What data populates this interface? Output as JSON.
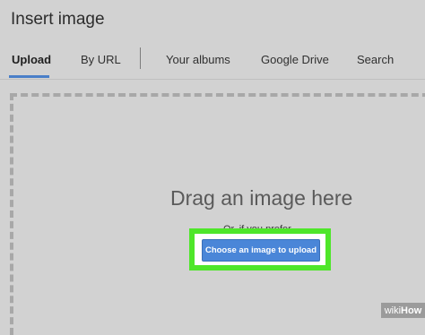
{
  "dialog": {
    "title": "Insert image"
  },
  "tabs": [
    {
      "label": "Upload",
      "active": true
    },
    {
      "label": "By URL",
      "active": false
    },
    {
      "label": "Your albums",
      "active": false
    },
    {
      "label": "Google Drive",
      "active": false
    },
    {
      "label": "Search",
      "active": false
    }
  ],
  "upload_area": {
    "headline": "Drag an image here",
    "secondary_text": "Or, if you prefer...",
    "button_label": "Choose an image to upload"
  },
  "watermark": {
    "part1": "wiki",
    "part2": "How"
  },
  "colors": {
    "accent": "#4a86d8",
    "highlight": "#4ee62a",
    "background": "#d2d2d2"
  }
}
